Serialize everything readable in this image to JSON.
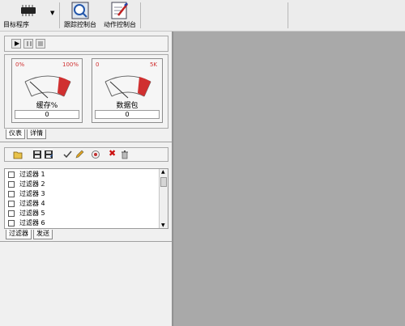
{
  "toolbar": {
    "target_label": "目标程序",
    "trace_label": "跟踪控制台",
    "action_label": "动作控制台"
  },
  "meters": [
    {
      "min": "0%",
      "max": "100%",
      "name": "缓存%",
      "value": "0"
    },
    {
      "min": "0",
      "max": "5K",
      "name": "数据包",
      "value": "0"
    }
  ],
  "meter_tabs": [
    "仪表",
    "详情"
  ],
  "filters": {
    "items": [
      "过滤器 1",
      "过滤器 2",
      "过滤器 3",
      "过滤器 4",
      "过滤器 5",
      "过滤器 6"
    ],
    "tabs": [
      "过滤器",
      "发送"
    ]
  },
  "colors": {
    "workspace": "#a9a9a9",
    "meter_red": "#d03030",
    "delete_red": "#cc1111"
  }
}
